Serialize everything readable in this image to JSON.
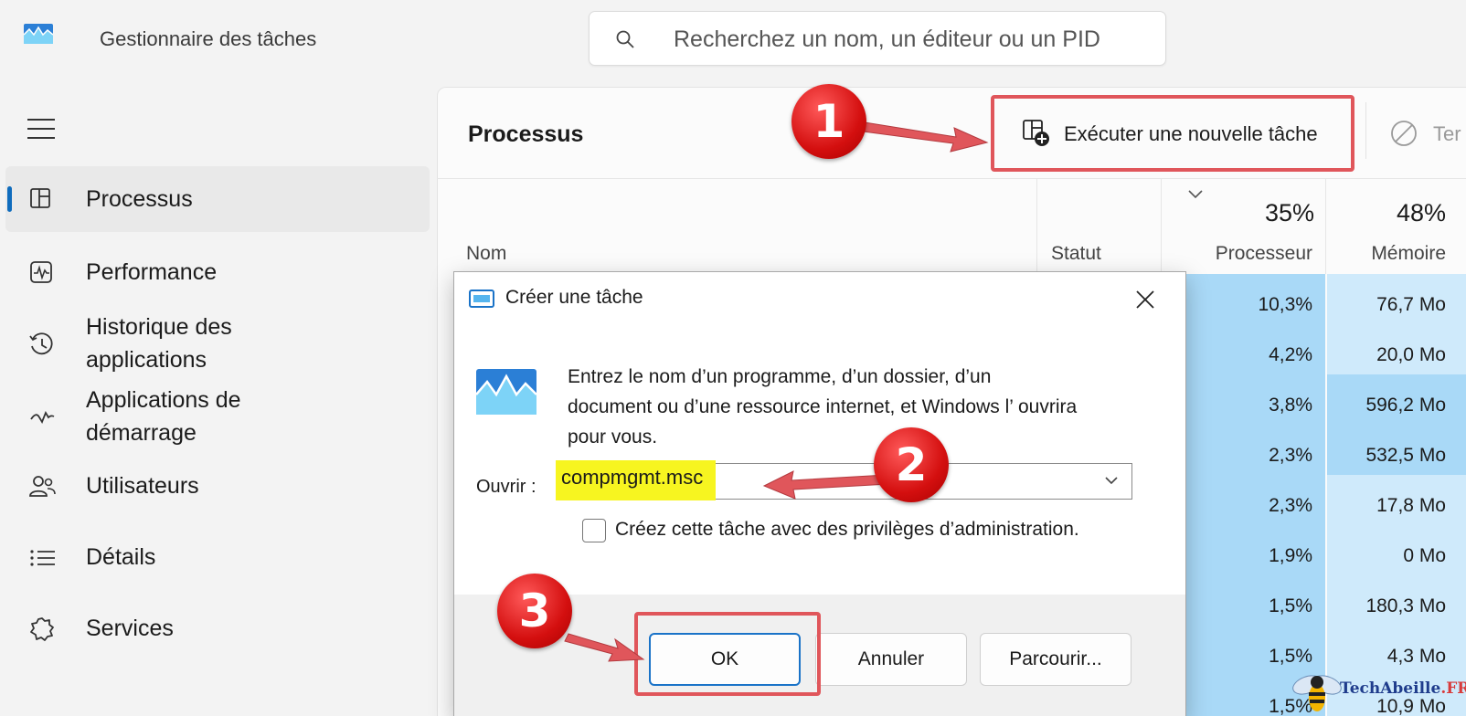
{
  "app": {
    "title": "Gestionnaire des tâches"
  },
  "search": {
    "placeholder": "Recherchez un nom, un éditeur ou un PID"
  },
  "sidebar": {
    "items": [
      {
        "label": "Processus",
        "icon": "processes-icon",
        "active": true
      },
      {
        "label": "Performance",
        "icon": "performance-icon"
      },
      {
        "label": "Historique des applications",
        "icon": "app-history-icon"
      },
      {
        "label": "Applications de démarrage",
        "icon": "startup-apps-icon"
      },
      {
        "label": "Utilisateurs",
        "icon": "users-icon"
      },
      {
        "label": "Détails",
        "icon": "details-icon"
      },
      {
        "label": "Services",
        "icon": "services-icon"
      }
    ]
  },
  "main": {
    "title": "Processus",
    "run_task_label": "Exécuter une nouvelle tâche",
    "end_task_label": "Ter",
    "columns": {
      "name": "Nom",
      "status": "Statut",
      "cpu_pct": "35%",
      "cpu": "Processeur",
      "mem_pct": "48%",
      "mem": "Mémoire"
    },
    "rows": [
      {
        "cpu": "10,3%",
        "mem": "76,7 Mo"
      },
      {
        "cpu": "4,2%",
        "mem": "20,0 Mo"
      },
      {
        "cpu": "3,8%",
        "mem": "596,2 Mo"
      },
      {
        "cpu": "2,3%",
        "mem": "532,5 Mo"
      },
      {
        "cpu": "2,3%",
        "mem": "17,8 Mo"
      },
      {
        "cpu": "1,9%",
        "mem": "0 Mo"
      },
      {
        "cpu": "1,5%",
        "mem": "180,3 Mo"
      },
      {
        "cpu": "1,5%",
        "mem": "4,3 Mo"
      },
      {
        "cpu": "1,5%",
        "mem": "10,9 Mo"
      }
    ]
  },
  "dialog": {
    "title": "Créer une tâche",
    "description": "Entrez le nom d’un programme, d’un dossier, d’un document ou d’une ressource internet, et Windows l’ ouvrira pour vous.",
    "open_label": "Ouvrir :",
    "open_value": "compmgmt.msc",
    "admin_label": "Créez cette tâche avec des privilèges d’administration.",
    "ok": "OK",
    "cancel": "Annuler",
    "browse": "Parcourir..."
  },
  "steps": [
    "1",
    "2",
    "3"
  ],
  "watermark": {
    "brand": "TechAbeille",
    "suffix": ".FR"
  },
  "colors": {
    "accent": "#0f6cbd",
    "highlight_frame": "#e0565b",
    "cpu_heat": "#a9d9f7",
    "mem_heat": "#cfeafb",
    "marker": "#d40f0f",
    "text_highlight": "#f7f520"
  }
}
